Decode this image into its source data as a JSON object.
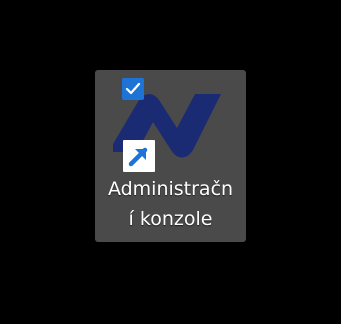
{
  "desktop": {
    "background_color": "#000000",
    "shortcut": {
      "label_line1": "Administračn",
      "label_line2": "í konzole",
      "selected": true,
      "selection_color": "#4a4a4a",
      "checkbox_checked": true,
      "checkbox_color": "#1e74d6",
      "icon": "n-logo-icon",
      "icon_color": "#1a2b73",
      "overlay_icon": "shortcut-arrow-icon",
      "overlay_arrow_color": "#1e74d6"
    }
  }
}
